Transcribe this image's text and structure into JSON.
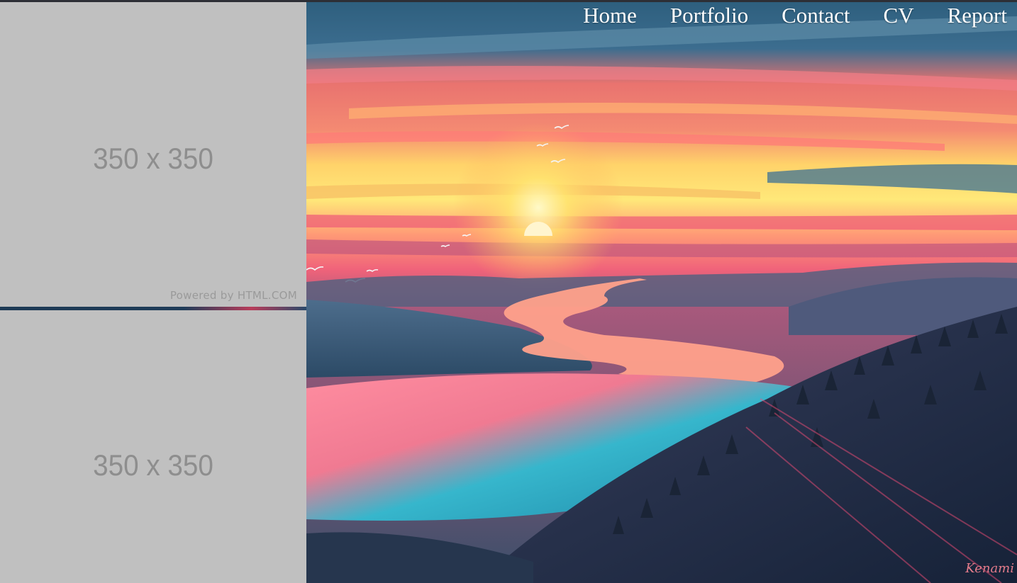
{
  "nav": {
    "items": [
      {
        "label": "Home"
      },
      {
        "label": "Portfolio"
      },
      {
        "label": "Contact"
      },
      {
        "label": "CV"
      },
      {
        "label": "Report"
      }
    ]
  },
  "placeholders": {
    "top": {
      "size_label": "350 x 350",
      "powered_by": "Powered by HTML.COM"
    },
    "bottom": {
      "size_label": "350 x 350"
    }
  },
  "hero": {
    "image": "sunset-river-landscape-illustration",
    "signature": "Kenami"
  },
  "colors": {
    "placeholder_bg": "#c0c0c0",
    "placeholder_text": "#8e8e8e",
    "nav_text": "#ffffff",
    "sun": "#fff3b0",
    "river": "#ff8fa0",
    "lake": "#2fb8d0"
  }
}
